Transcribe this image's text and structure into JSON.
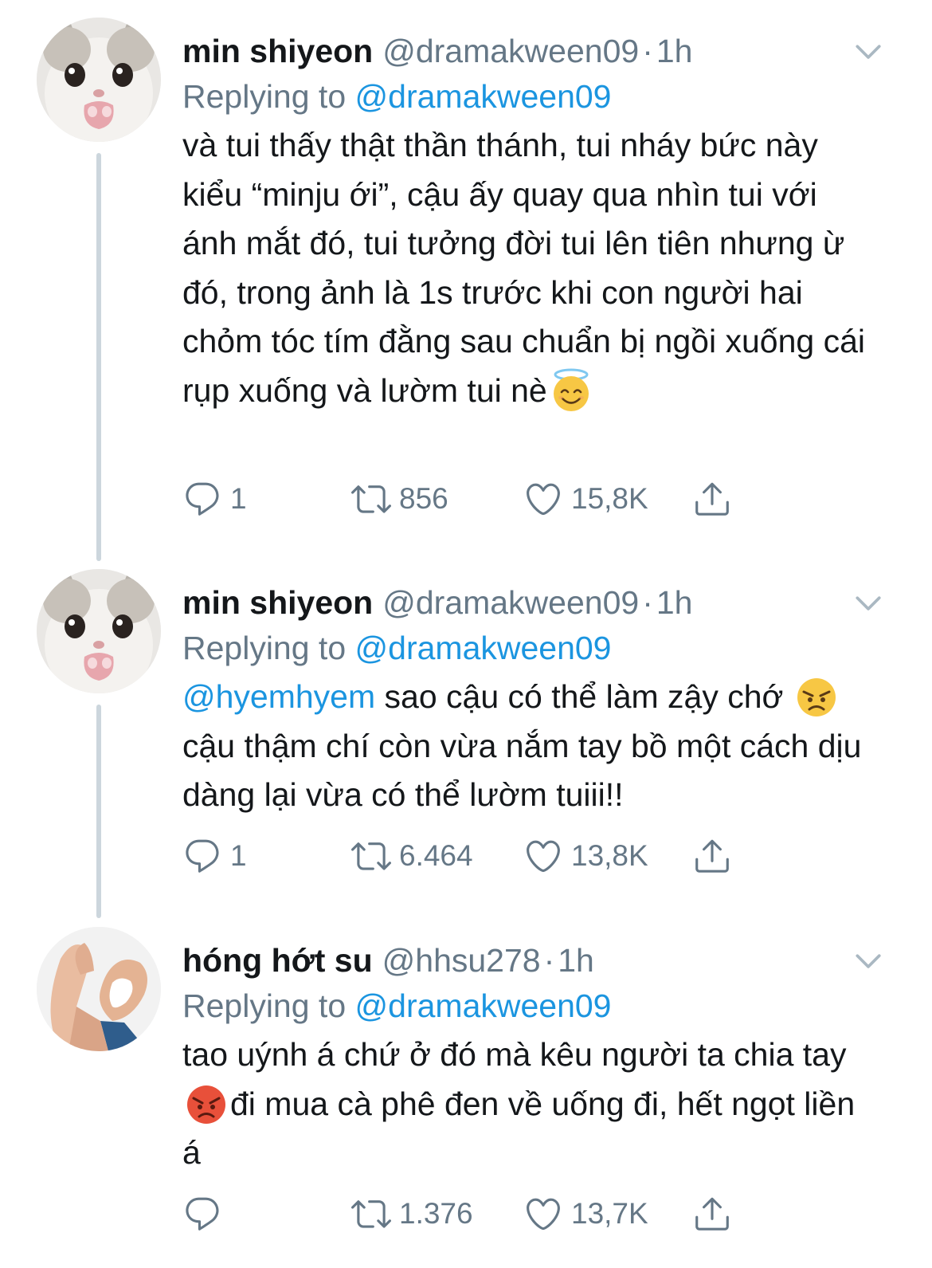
{
  "tweets": [
    {
      "name": "min shiyeon",
      "handle": "@dramakween09",
      "dot": "·",
      "time": "1h",
      "replying_prefix": "Replying to",
      "replying_to": "@dramakween09",
      "body_mention": "",
      "body_before": "và tui thấy thật thần thánh, tui nháy bức này kiểu “minju ới”, cậu ấy quay qua nhìn tui với ánh mắt đó, tui tưởng đời tui lên tiên nhưng ừ đó, trong ảnh là 1s trước khi con người hai chỏm tóc tím đằng sau chuẩn bị ngồi xuống cái rụp xuống và lườm tui nè",
      "body_after": "",
      "emoji": "smiling-face-with-halo",
      "replies": "1",
      "retweets": "856",
      "likes": "15,8K",
      "avatar": "crying-cat-avatar"
    },
    {
      "name": "min shiyeon",
      "handle": "@dramakween09",
      "dot": "·",
      "time": "1h",
      "replying_prefix": "Replying to",
      "replying_to": "@dramakween09",
      "body_mention": "@hyemhyem",
      "body_before": " sao cậu có thể làm zậy chớ ",
      "body_after": " cậu thậm chí còn vừa nắm tay bồ một cách dịu dàng lại vừa có thể lườm tuiii!!",
      "emoji": "angry-face",
      "replies": "1",
      "retweets": "6.464",
      "likes": "13,8K",
      "avatar": "crying-cat-avatar"
    },
    {
      "name": "hóng hớt su",
      "handle": "@hhsu278",
      "dot": "·",
      "time": "1h",
      "replying_prefix": "Replying to",
      "replying_to": "@dramakween09",
      "body_mention": "",
      "body_before": "tao uýnh á chứ ở đó mà kêu người ta chia tay",
      "body_after": "đi mua cà phê đen về uống đi, hết ngọt liền á",
      "emoji": "pouting-face",
      "replies": "",
      "retweets": "1.376",
      "likes": "13,7K",
      "avatar": "ok-hand-heart-avatar"
    }
  ],
  "colors": {
    "text": "#14171a",
    "secondary": "#657786",
    "link": "#1b95e0",
    "thread_line": "#ccd6dd"
  },
  "icons": [
    "reply-icon",
    "retweet-icon",
    "like-icon",
    "share-icon",
    "chevron-down-icon"
  ]
}
